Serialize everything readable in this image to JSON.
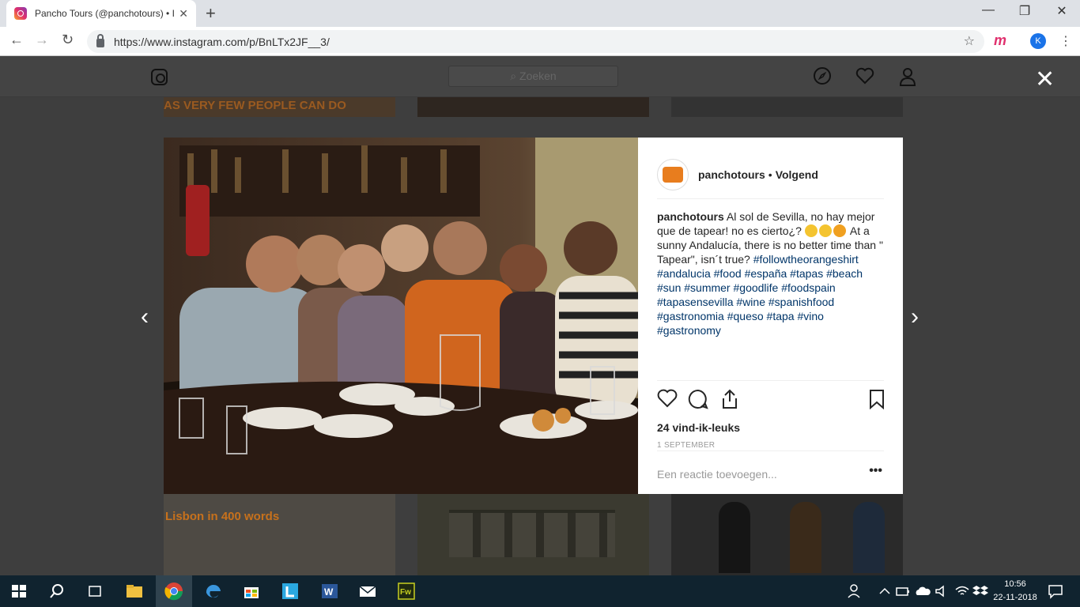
{
  "browser": {
    "tab_title": "Pancho Tours (@panchotours) • I",
    "tab_close": "✕",
    "new_tab": "+",
    "url": "https://www.instagram.com/p/BnLTx2JF__3/",
    "profile_initial": "K",
    "ext_label": "m",
    "menu": "⋮",
    "bookmark_star": "☆",
    "back": "←",
    "forward": "→",
    "reload": "↻",
    "minimize": "—",
    "maximize": "❐",
    "close": "✕"
  },
  "instagram": {
    "search_placeholder": "⌕ Zoeken",
    "close_modal": "✕",
    "nav_prev": "‹",
    "nav_next": "›",
    "grid_title": "Lisbon in 400 words",
    "grid_banner": "AS VERY FEW PEOPLE CAN DO"
  },
  "post": {
    "username": "panchotours",
    "separator": "•",
    "follow_status": "Volgend",
    "caption_user": "panchotours",
    "caption_text_1": "Al sol de Sevilla, no hay mejor que de tapear! no es cierto¿?",
    "caption_text_2": "At a sunny Andalucía, there is no better time than \" Tapear\", isn´t true?",
    "hashtags": [
      "#followtheorangeshirt",
      "#andalucia",
      "#food",
      "#españa",
      "#tapas",
      "#beach",
      "#sun",
      "#summer",
      "#goodlife",
      "#foodspain",
      "#tapasensevilla",
      "#wine",
      "#spanishfood",
      "#gastronomia",
      "#queso",
      "#tapa",
      "#vino",
      "#gastronomy"
    ],
    "likes": "24 vind-ik-leuks",
    "date": "1 SEPTEMBER",
    "comment_placeholder": "Een reactie toevoegen...",
    "more": "•••"
  },
  "taskbar": {
    "time": "10:56",
    "date": "22-11-2018"
  },
  "colors": {
    "accent_orange": "#e87d1e",
    "hashtag_blue": "#003569",
    "taskbar_bg": "#10232f"
  }
}
